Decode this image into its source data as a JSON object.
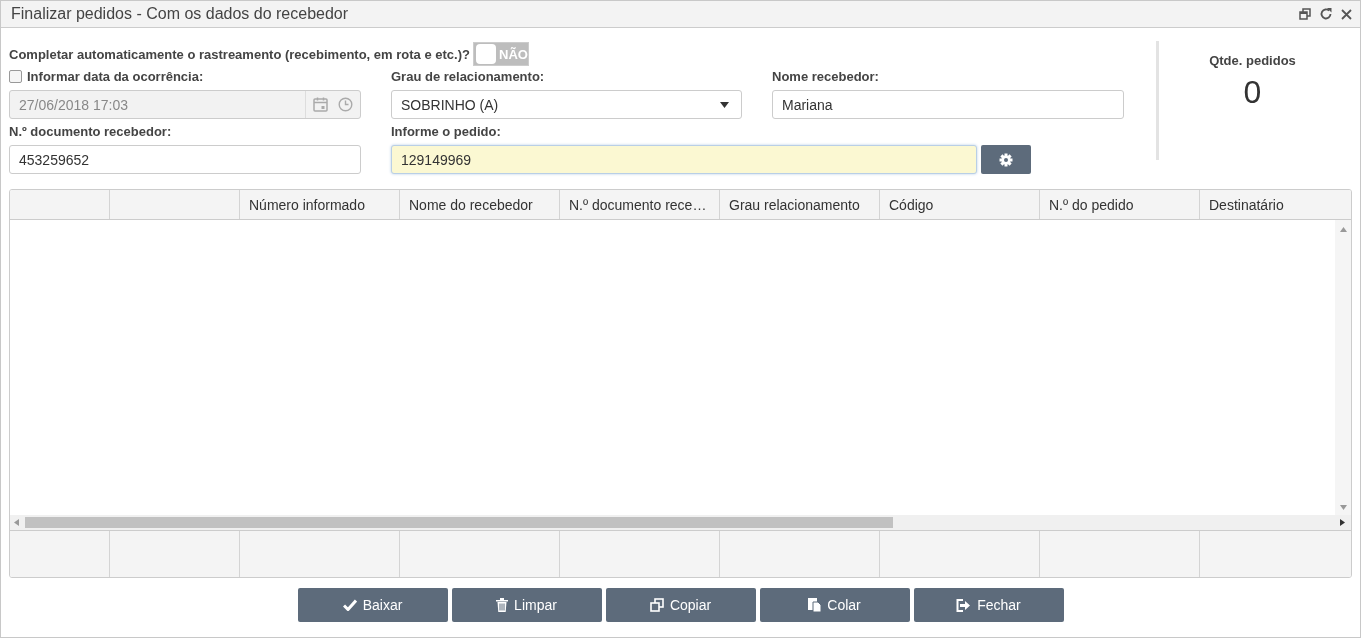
{
  "window": {
    "title": "Finalizar pedidos - Com os dados do recebedor"
  },
  "auto_complete": {
    "label": "Completar automaticamente o rastreamento (recebimento, em rota e etc.)?",
    "toggle_text": "NÃO",
    "on": false
  },
  "occurrence_date": {
    "label": "Informar data da ocorrência:",
    "checked": false,
    "value": "27/06/2018 17:03",
    "disabled": true
  },
  "relationship": {
    "label": "Grau de relacionamento:",
    "value": "SOBRINHO (A)"
  },
  "receiver_name": {
    "label": "Nome recebedor:",
    "value": "Mariana"
  },
  "receiver_document": {
    "label": "N.º documento recebedor:",
    "value": "453259652"
  },
  "order": {
    "label": "Informe o pedido:",
    "value": "129149969"
  },
  "order_count": {
    "label": "Qtde. pedidos",
    "value": "0"
  },
  "table": {
    "columns": [
      "Número informado",
      "Nome do recebedor",
      "N.º documento rece…",
      "Grau relacionamento",
      "Código",
      "N.º do pedido",
      "Destinatário"
    ]
  },
  "buttons": [
    {
      "label": "Baixar",
      "kind": "check"
    },
    {
      "label": "Limpar",
      "kind": "trash"
    },
    {
      "label": "Copiar",
      "kind": "copy"
    },
    {
      "label": "Colar",
      "kind": "paste"
    },
    {
      "label": "Fechar",
      "kind": "exit"
    }
  ]
}
